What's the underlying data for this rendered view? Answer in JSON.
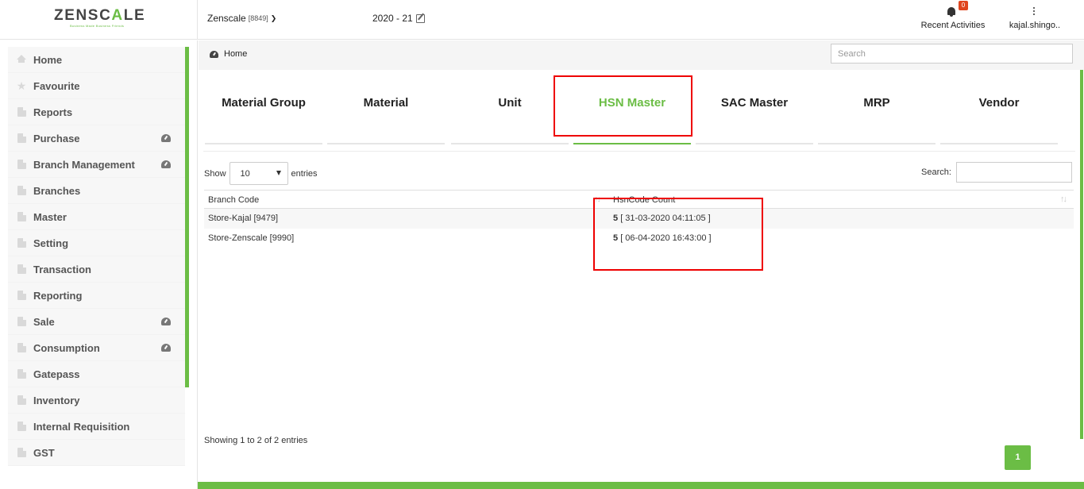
{
  "header": {
    "logo_main": "ZENSC",
    "logo_accent": "A",
    "logo_end": "LE",
    "logo_tagline": "Business Made Business Friends",
    "company_name": "Zenscale",
    "company_code": "[8849]",
    "fiscal_year": "2020 - 21",
    "notifications_count": "0",
    "recent_activities_label": "Recent Activities",
    "user_name": "kajal.shingo.."
  },
  "sidebar": {
    "items": [
      {
        "label": "Home",
        "icon": "home-icon"
      },
      {
        "label": "Favourite",
        "icon": "star-icon"
      },
      {
        "label": "Reports",
        "icon": "file-icon"
      },
      {
        "label": "Purchase",
        "icon": "folder-icon",
        "badge_icon": "dashboard-icon"
      },
      {
        "label": "Branch Management",
        "icon": "folder-icon",
        "badge_icon": "dashboard-icon"
      },
      {
        "label": "Branches",
        "icon": "folder-icon"
      },
      {
        "label": "Master",
        "icon": "folder-icon"
      },
      {
        "label": "Setting",
        "icon": "folder-icon"
      },
      {
        "label": "Transaction",
        "icon": "folder-icon"
      },
      {
        "label": "Reporting",
        "icon": "folder-icon"
      },
      {
        "label": "Sale",
        "icon": "folder-icon",
        "badge_icon": "dashboard-icon"
      },
      {
        "label": "Consumption",
        "icon": "folder-icon",
        "badge_icon": "dashboard-icon"
      },
      {
        "label": "Gatepass",
        "icon": "folder-icon"
      },
      {
        "label": "Inventory",
        "icon": "folder-icon"
      },
      {
        "label": "Internal Requisition",
        "icon": "folder-icon"
      },
      {
        "label": "GST",
        "icon": "folder-icon"
      }
    ]
  },
  "breadcrumb": {
    "label": "Home",
    "search_placeholder": "Search"
  },
  "tabs": [
    {
      "label": "Material Group",
      "active": false
    },
    {
      "label": "Material",
      "active": false
    },
    {
      "label": "Unit",
      "active": false
    },
    {
      "label": "HSN Master",
      "active": true
    },
    {
      "label": "SAC Master",
      "active": false
    },
    {
      "label": "MRP",
      "active": false
    },
    {
      "label": "Vendor",
      "active": false
    }
  ],
  "table_controls": {
    "show_label": "Show",
    "page_length": "10",
    "entries_label": "entries",
    "search_label": "Search:"
  },
  "table": {
    "columns": [
      "Branch Code",
      "HsnCode Count"
    ],
    "rows": [
      {
        "branch": "Store-Kajal [9479]",
        "count": "5",
        "timestamp": "[ 31-03-2020 04:11:05 ]"
      },
      {
        "branch": "Store-Zenscale [9990]",
        "count": "5",
        "timestamp": "[ 06-04-2020 16:43:00 ]"
      }
    ]
  },
  "footer": {
    "info": "Showing 1 to 2 of 2 entries",
    "current_page": "1"
  },
  "colors": {
    "accent": "#6bbd45",
    "highlight": "#e00000",
    "badge": "#e0461f"
  }
}
